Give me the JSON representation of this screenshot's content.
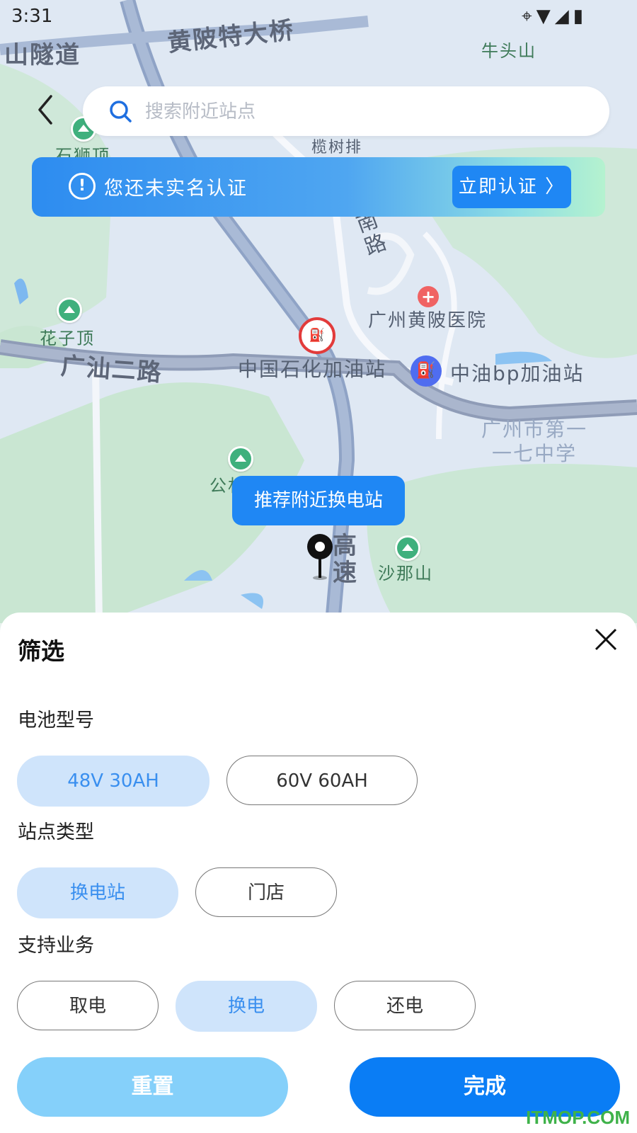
{
  "status_bar": {
    "time": "3:31"
  },
  "search": {
    "placeholder": "搜索附近站点"
  },
  "banner": {
    "text": "您还未实名认证",
    "button_label": "立即认证 〉",
    "icon": "alert-circle-icon"
  },
  "map": {
    "labels": {
      "tunnel": "山隧道",
      "bridge": "黄陂特大桥",
      "mountain_niutou": "牛头山",
      "mountain_shishi": "石狮顶",
      "village": "榄树排",
      "road_tianlu": "天鹿南路",
      "hospital": "广州黄陂医院",
      "mountain_huazi": "花子顶",
      "road_guangshan": "广汕二路",
      "sinopec": "中国石化加油站",
      "bp": "中油bp加油站",
      "school": "广州市第一一七中学",
      "park": "公林",
      "highway": "高速",
      "mountain_shana": "沙那山"
    },
    "recommend_label": "推荐附近换电站"
  },
  "filter": {
    "title": "筛选",
    "battery": {
      "title": "电池型号",
      "options": [
        "48V 30AH",
        "60V 60AH"
      ],
      "selected": 0
    },
    "station": {
      "title": "站点类型",
      "options": [
        "换电站",
        "门店"
      ],
      "selected": 0
    },
    "business": {
      "title": "支持业务",
      "options": [
        "取电",
        "换电",
        "还电"
      ],
      "selected": 1
    },
    "reset_label": "重置",
    "done_label": "完成"
  },
  "watermark": "ITMOP.COM",
  "colors": {
    "accent": "#1f87f4",
    "chip_selected_bg": "#cfe4fb",
    "reset_bg": "#85d0fa",
    "done_bg": "#0a7df5"
  }
}
